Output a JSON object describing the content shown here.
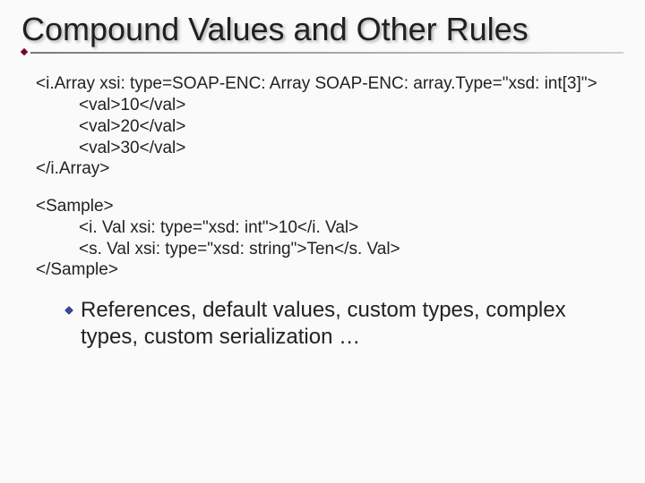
{
  "title": "Compound Values and Other Rules",
  "code1": {
    "line1": "<i.Array xsi: type=SOAP-ENC: Array SOAP-ENC: array.Type=\"xsd: int[3]\">",
    "line2": "<val>10</val>",
    "line3": "<val>20</val>",
    "line4": "<val>30</val>",
    "line5": "</i.Array>"
  },
  "code2": {
    "line1": "<Sample>",
    "line2": "<i. Val xsi: type=\"xsd: int\">10</i. Val>",
    "line3": "<s. Val xsi: type=\"xsd: string\">Ten</s. Val>",
    "line4": "</Sample>"
  },
  "bullet_text": "References, default values, custom types, complex types, custom serialization …"
}
